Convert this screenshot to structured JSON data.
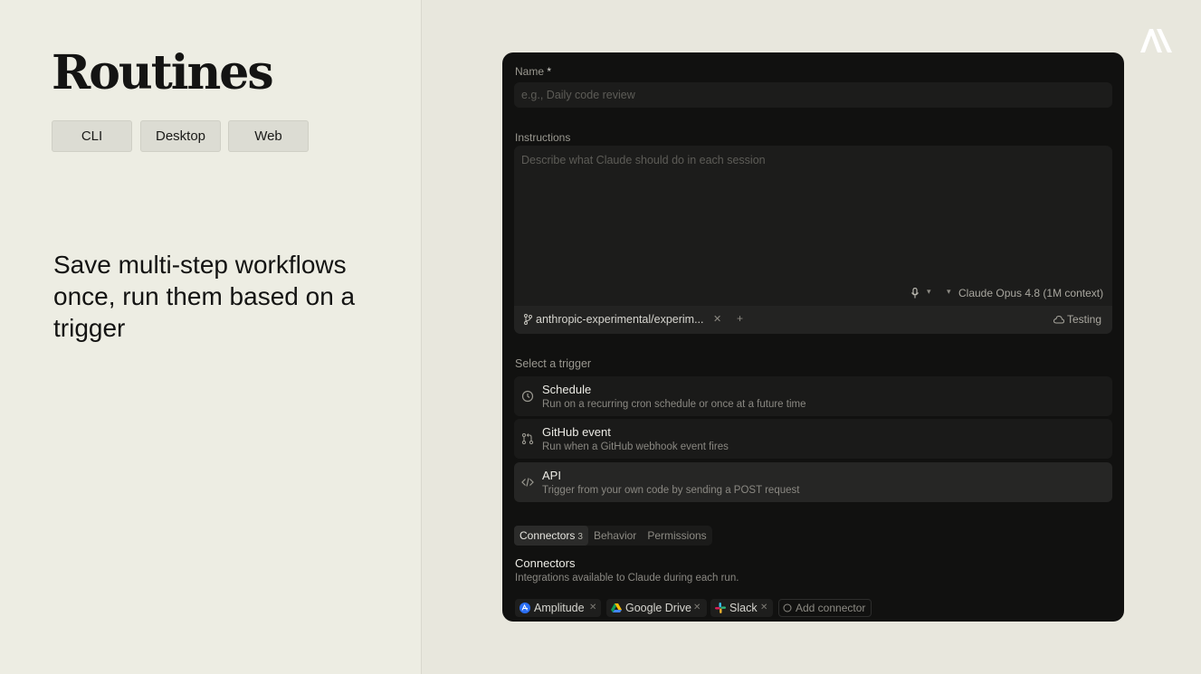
{
  "slide": {
    "title": "Routines",
    "platforms": [
      "CLI",
      "Desktop",
      "Web"
    ],
    "tagline": "Save multi-step workflows once, run them based on a trigger"
  },
  "brand": {
    "logo_icon": "anthropic-logo-icon"
  },
  "form": {
    "name_label": "Name",
    "name_required_mark": "*",
    "name_placeholder": "e.g., Daily code review",
    "instructions_label": "Instructions",
    "instructions_placeholder": "Describe what Claude should do in each session",
    "model": "Claude Opus 4.8 (1M context)",
    "repo": "anthropic-experimental/experim...",
    "repo_add": "+",
    "environment": "Testing",
    "trigger_label": "Select a trigger",
    "triggers": [
      {
        "title": "Schedule",
        "description": "Run on a recurring cron schedule or once at a future time",
        "icon": "clock-icon"
      },
      {
        "title": "GitHub event",
        "description": "Run when a GitHub webhook event fires",
        "icon": "git-pull-request-icon"
      },
      {
        "title": "API",
        "description": "Trigger from your own code by sending a POST request",
        "icon": "code-icon"
      }
    ],
    "tabs": [
      {
        "label": "Connectors",
        "count": "3"
      },
      {
        "label": "Behavior"
      },
      {
        "label": "Permissions"
      }
    ],
    "connectors_title": "Connectors",
    "connectors_desc": "Integrations available to Claude during each run.",
    "connectors": [
      {
        "name": "Amplitude",
        "icon": "amplitude-icon"
      },
      {
        "name": "Google Drive",
        "icon": "google-drive-icon"
      },
      {
        "name": "Slack",
        "icon": "slack-icon"
      }
    ],
    "add_connector": "Add connector"
  },
  "colors": {
    "slide_bg": "#edede3",
    "window_bg": "#111110",
    "selected_trigger_bg": "#262625"
  }
}
